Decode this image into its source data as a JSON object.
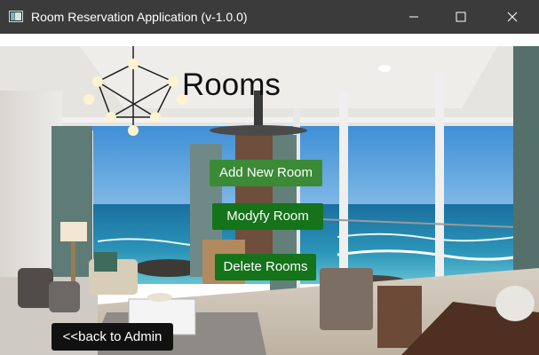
{
  "window": {
    "title": "Room Reservation Application (v-1.0.0)",
    "controls": {
      "minimize": "minimize-icon",
      "maximize": "maximize-icon",
      "close": "close-icon"
    }
  },
  "page": {
    "heading": "Rooms",
    "buttons": {
      "add": "Add New Room",
      "modify": "Modyfy Room",
      "delete": "Delete Rooms"
    },
    "back_label": "<<back to Admin"
  },
  "colors": {
    "titlebar": "#3b3b3b",
    "button_green": "#15731a",
    "button_green_light": "#3a8a36",
    "back_button": "#111111"
  }
}
